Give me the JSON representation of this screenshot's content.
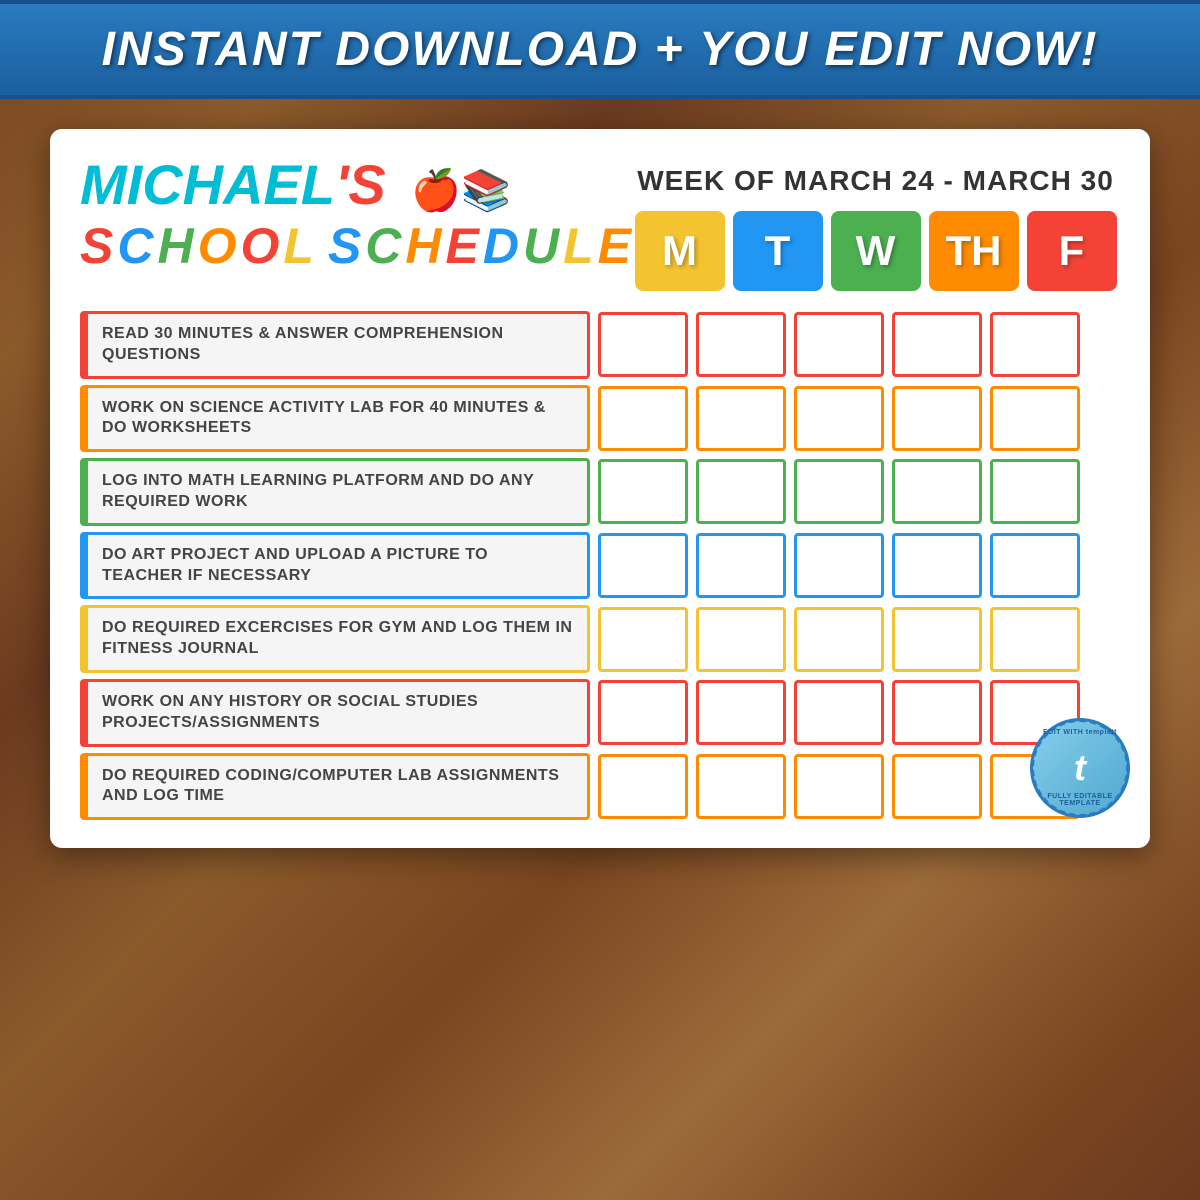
{
  "banner": {
    "text": "INSTANT DOWNLOAD + YOU EDIT NOW!"
  },
  "header": {
    "name": "MICHAEL'S",
    "title_line1": "MICHAEL'S",
    "title_line2": "SCHOOL SCHEDULE",
    "schedule_letters": [
      {
        "letter": "S",
        "color": "#f44336"
      },
      {
        "letter": "C",
        "color": "#2196f3"
      },
      {
        "letter": "H",
        "color": "#4caf50"
      },
      {
        "letter": "O",
        "color": "#ff8c00"
      },
      {
        "letter": "O",
        "color": "#f44336"
      },
      {
        "letter": "L",
        "color": "#f4c430"
      }
    ],
    "week": "WEEK OF MARCH 24 - MARCH 30",
    "days": [
      {
        "label": "M",
        "color_class": "day-mon"
      },
      {
        "label": "T",
        "color_class": "day-tue"
      },
      {
        "label": "W",
        "color_class": "day-wed"
      },
      {
        "label": "TH",
        "color_class": "day-thu"
      },
      {
        "label": "F",
        "color_class": "day-fri"
      }
    ]
  },
  "tasks": [
    {
      "text": "READ 30 MINUTES & ANSWER COMPREHENSION QUESTIONS",
      "color": "red",
      "cb_color": "cb-red"
    },
    {
      "text": "WORK ON SCIENCE ACTIVITY LAB FOR 40 MINUTES & DO WORKSHEETS",
      "color": "orange",
      "cb_color": "cb-orange"
    },
    {
      "text": "LOG INTO MATH LEARNING PLATFORM AND DO ANY REQUIRED WORK",
      "color": "green",
      "cb_color": "cb-green"
    },
    {
      "text": "DO ART PROJECT AND UPLOAD A PICTURE TO TEACHER IF NECESSARY",
      "color": "blue",
      "cb_color": "cb-blue"
    },
    {
      "text": "DO REQUIRED EXCERCISES FOR GYM AND LOG THEM IN FITNESS JOURNAL",
      "color": "yellow",
      "cb_color": "cb-yellow"
    },
    {
      "text": "WORK ON ANY HISTORY OR SOCIAL STUDIES PROJECTS/ASSIGNMENTS",
      "color": "red",
      "cb_color": "cb-red"
    },
    {
      "text": "DO REQUIRED CODING/COMPUTER LAB ASSIGNMENTS AND LOG TIME",
      "color": "orange",
      "cb_color": "cb-orange"
    }
  ],
  "templett": {
    "top": "EDIT WITH templett",
    "letter": "t",
    "bottom": "FULLY EDITABLE TEMPLATE"
  }
}
